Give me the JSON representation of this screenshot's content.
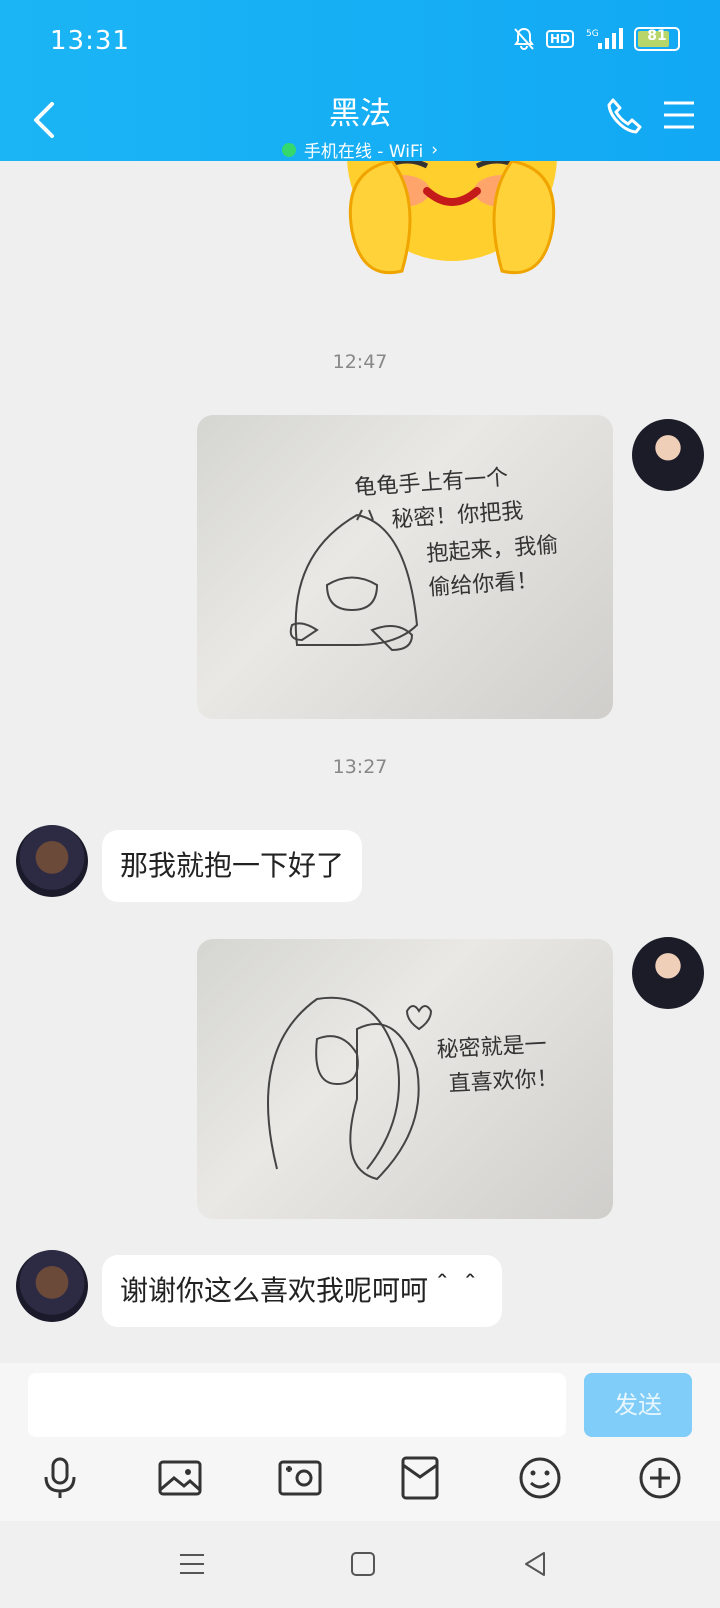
{
  "status_bar": {
    "time": "13:31",
    "battery": "81",
    "network": "5G",
    "hd": "HD"
  },
  "header": {
    "title": "黑法",
    "subtitle": "手机在线 - WiFi",
    "subtitle_chevron": "›"
  },
  "messages": {
    "ts1": "12:47",
    "ts2": "13:27",
    "msg1": "那我就抱一下好了",
    "msg2": "谢谢你这么喜欢我呢呵呵＾＾"
  },
  "sketch1": {
    "lines": [
      "龟龟手上有一个",
      "秘密！你把我",
      "抱起来，我偷",
      "偷给你看！"
    ]
  },
  "sketch2": {
    "lines": [
      "秘密就是一",
      "直喜欢你！"
    ]
  },
  "input": {
    "placeholder": "",
    "send_label": "发送"
  },
  "toolbar": [
    "microphone-icon",
    "image-icon",
    "camera-icon",
    "red-packet-icon",
    "emoji-icon",
    "plus-icon"
  ],
  "colors": {
    "header": "#12a8f4",
    "send_disabled": "#7fcdf8",
    "online": "#34d86d"
  }
}
